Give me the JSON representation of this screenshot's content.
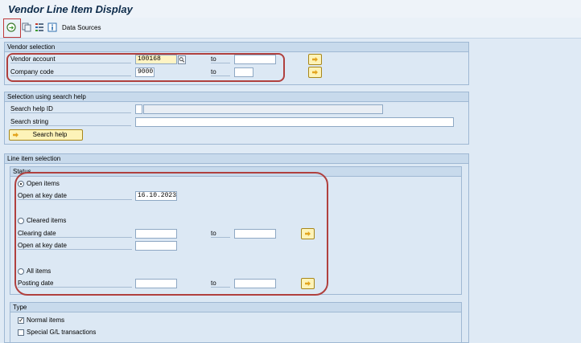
{
  "app": {
    "title": "Vendor Line Item Display"
  },
  "toolbar": {
    "execute_icon": "execute-icon",
    "data_sources_label": "Data Sources"
  },
  "vendor_selection": {
    "heading": "Vendor selection",
    "vendor_account_label": "Vendor account",
    "vendor_account_value": "100168",
    "company_code_label": "Company code",
    "company_code_value": "9000",
    "to_label": "to"
  },
  "search_help": {
    "heading": "Selection using search help",
    "search_help_id_label": "Search help ID",
    "search_string_label": "Search string",
    "search_help_button": "Search help"
  },
  "line_item": {
    "heading": "Line item selection",
    "status_heading": "Status",
    "open_items_label": "Open items",
    "open_key_date_label": "Open at key date",
    "open_key_date_value": "16.10.2023",
    "cleared_items_label": "Cleared items",
    "clearing_date_label": "Clearing date",
    "cleared_open_key_date_label": "Open at key date",
    "all_items_label": "All items",
    "posting_date_label": "Posting date",
    "to_label": "to"
  },
  "type": {
    "heading": "Type",
    "normal_items_label": "Normal items",
    "normal_items_checked": true,
    "special_gl_label": "Special G/L transactions",
    "special_gl_checked": false
  },
  "colors": {
    "highlight_border": "#c03a3a",
    "required_field": "#fff4c4"
  }
}
